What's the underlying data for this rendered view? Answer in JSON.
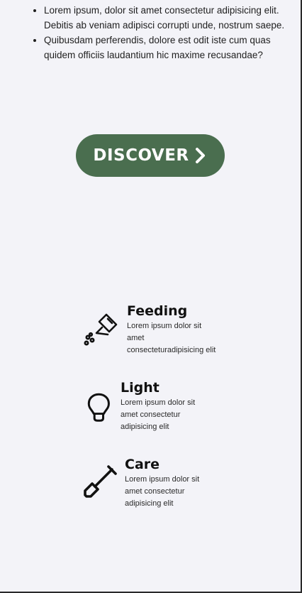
{
  "list": {
    "items": [
      {
        "text": "Lorem ipsum, dolor sit amet consectetur adipisicing elit. Debitis ab veniam adipisci corrupti unde, nostrum saepe."
      },
      {
        "text": "Quibusdam perferendis, dolore est odit iste cum quas quidem officiis laudantium hic maxime recusandae?"
      }
    ]
  },
  "cta": {
    "label": "DISCOVER",
    "icon": "chevron-right-icon",
    "bg_color": "#4a6e4f"
  },
  "features": [
    {
      "title": "Feeding",
      "lines": [
        "Lorem ipsum dolor sit",
        "amet",
        "consecteturadipisicing elit"
      ],
      "icon": "watering-can-icon"
    },
    {
      "title": "Light",
      "lines": [
        "Lorem ipsum dolor sit",
        "amet consectetur",
        "adipisicing elit"
      ],
      "icon": "lightbulb-icon"
    },
    {
      "title": "Care",
      "lines": [
        "Lorem ipsum dolor sit",
        "amet consectetur",
        "adipisicing elit"
      ],
      "icon": "shovel-icon"
    }
  ]
}
